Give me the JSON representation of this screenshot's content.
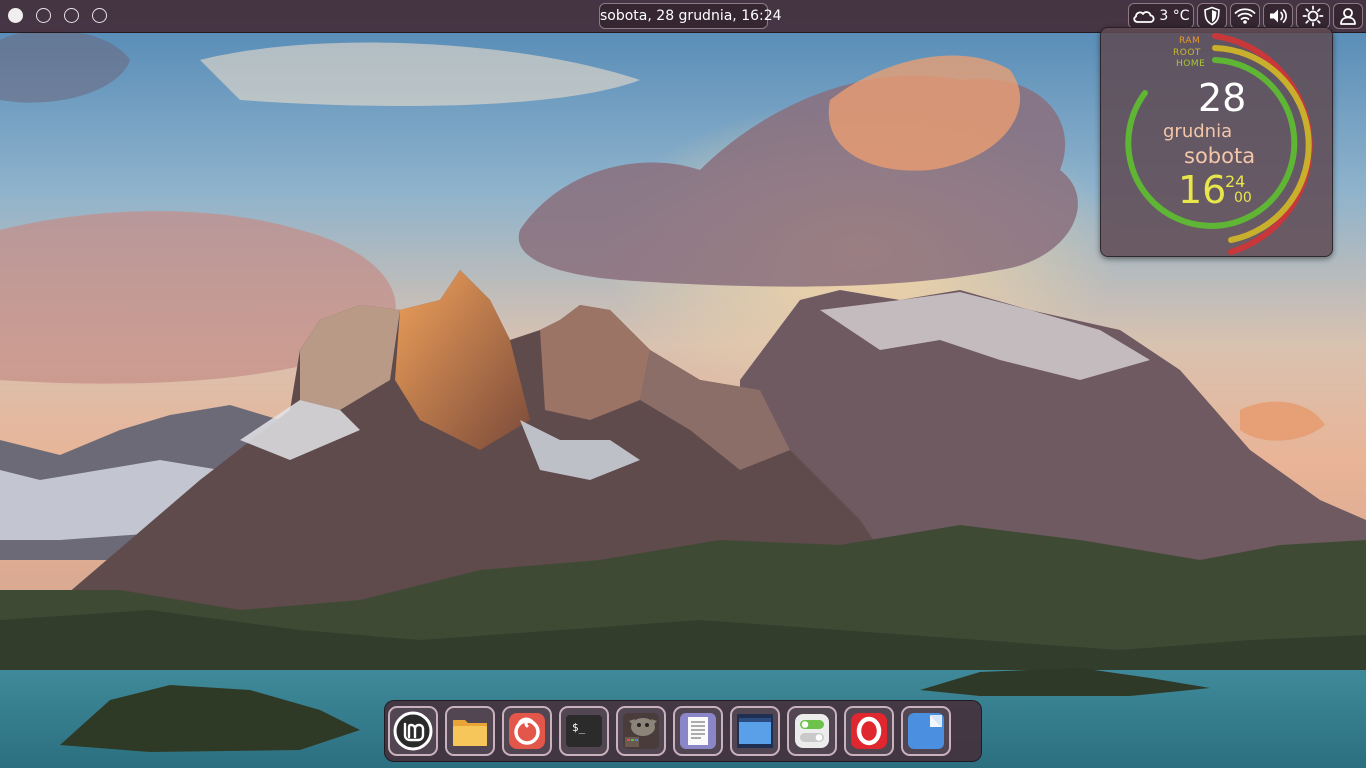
{
  "panel": {
    "clock_text": "sobota, 28 grudnia, 16:24",
    "weather_text": "3 °C",
    "tray_icons": [
      "weather-cloud-icon",
      "shield-icon",
      "wifi-icon",
      "volume-icon",
      "brightness-icon",
      "user-icon"
    ]
  },
  "widget": {
    "labels": {
      "ram": "RAM",
      "root": "ROOT",
      "home": "HOME"
    },
    "day": "28",
    "month": "grudnia",
    "weekday": "sobota",
    "hour": "16",
    "minute": "24",
    "second": "00",
    "meter_colors": {
      "ram": "#c8373a",
      "root": "#c9b02c",
      "home": "#5fb534"
    }
  },
  "dock": {
    "items": [
      "mint-menu-icon",
      "files-icon",
      "firefox-icon",
      "terminal-icon",
      "gimp-icon",
      "text-editor-icon",
      "window-manager-icon",
      "settings-toggle-icon",
      "opera-icon",
      "document-viewer-icon"
    ]
  }
}
